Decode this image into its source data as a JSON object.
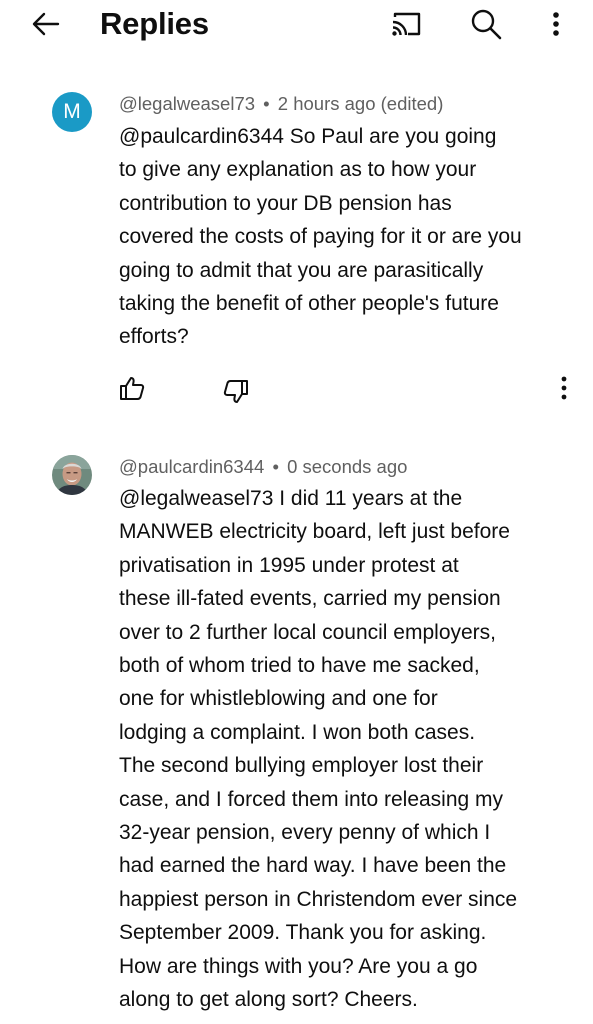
{
  "header": {
    "title": "Replies",
    "icons": [
      "back-arrow-icon",
      "cast-icon",
      "search-icon",
      "more-vert-icon"
    ]
  },
  "comments": [
    {
      "avatar_letter": "M",
      "avatar_color": "#1a9ac6",
      "author": "@legalweasel73",
      "separator": "•",
      "time": "2 hours ago (edited)",
      "text": "@paulcardin6344  So Paul are you going\nto give any explanation as to how your\ncontribution to your DB pension has\ncovered the costs of paying for it or are you\ngoing to admit that you are parasitically\ntaking the benefit of other people's future\nefforts?"
    },
    {
      "avatar_icon": "user-photo-avatar",
      "author": "@paulcardin6344",
      "separator": "•",
      "time": "0 seconds ago",
      "text": "@legalweasel73  I did 11 years at the\nMANWEB electricity board, left just before\nprivatisation in 1995 under protest at\nthese ill-fated events, carried my pension\nover to 2 further local council employers,\nboth of whom tried to have me sacked,\none for whistleblowing and one for\nlodging a complaint. I won both cases.\nThe second bullying employer lost their\ncase, and I forced them into releasing my\n32-year pension, every penny of which I\nhad earned the hard way. I have been the\nhappiest person in Christendom ever since\nSeptember 2009. Thank you for asking.\nHow are things with you? Are you a go\nalong to get along sort? Cheers."
    }
  ]
}
